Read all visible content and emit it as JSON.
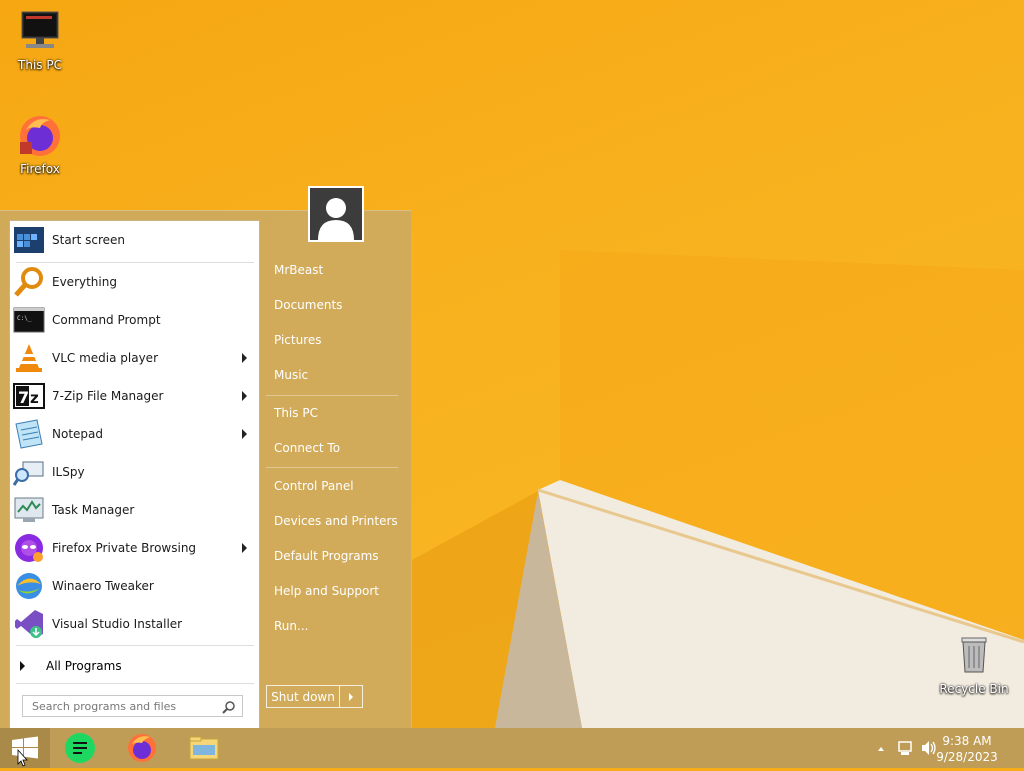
{
  "desktop": {
    "icons": [
      {
        "label": "This PC",
        "icon": "this-pc-icon"
      },
      {
        "label": "Firefox",
        "icon": "firefox-icon"
      },
      {
        "label": "Recycle Bin",
        "icon": "recycle-bin-icon"
      }
    ]
  },
  "start_menu": {
    "pinned": [
      {
        "label": "Start screen",
        "icon": "start-screen-icon",
        "submenu": false
      },
      {
        "label": "Everything",
        "icon": "everything-search-icon",
        "submenu": false
      },
      {
        "label": "Command Prompt",
        "icon": "command-prompt-icon",
        "submenu": false
      },
      {
        "label": "VLC media player",
        "icon": "vlc-icon",
        "submenu": true
      },
      {
        "label": "7-Zip File Manager",
        "icon": "7zip-icon",
        "submenu": true
      },
      {
        "label": "Notepad",
        "icon": "notepad-icon",
        "submenu": true
      },
      {
        "label": "ILSpy",
        "icon": "ilspy-icon",
        "submenu": false
      },
      {
        "label": "Task Manager",
        "icon": "task-manager-icon",
        "submenu": false
      },
      {
        "label": "Firefox Private Browsing",
        "icon": "firefox-private-icon",
        "submenu": true
      },
      {
        "label": "Winaero Tweaker",
        "icon": "winaero-tweaker-icon",
        "submenu": false
      },
      {
        "label": "Visual Studio Installer",
        "icon": "visual-studio-installer-icon",
        "submenu": false
      }
    ],
    "all_programs": "All Programs",
    "search_placeholder": "Search programs and files",
    "user_name": "MrBeast",
    "right_items": [
      "Documents",
      "Pictures",
      "Music",
      "This PC",
      "Connect To",
      "Control Panel",
      "Devices and Printers",
      "Default Programs",
      "Help and Support",
      "Run..."
    ],
    "shutdown_label": "Shut down"
  },
  "taskbar": {
    "pinned": [
      "start-button-icon",
      "notes-app-icon",
      "firefox-icon",
      "file-explorer-icon"
    ],
    "tray": {
      "time": "9:38 AM",
      "date": "9/28/2023"
    }
  }
}
